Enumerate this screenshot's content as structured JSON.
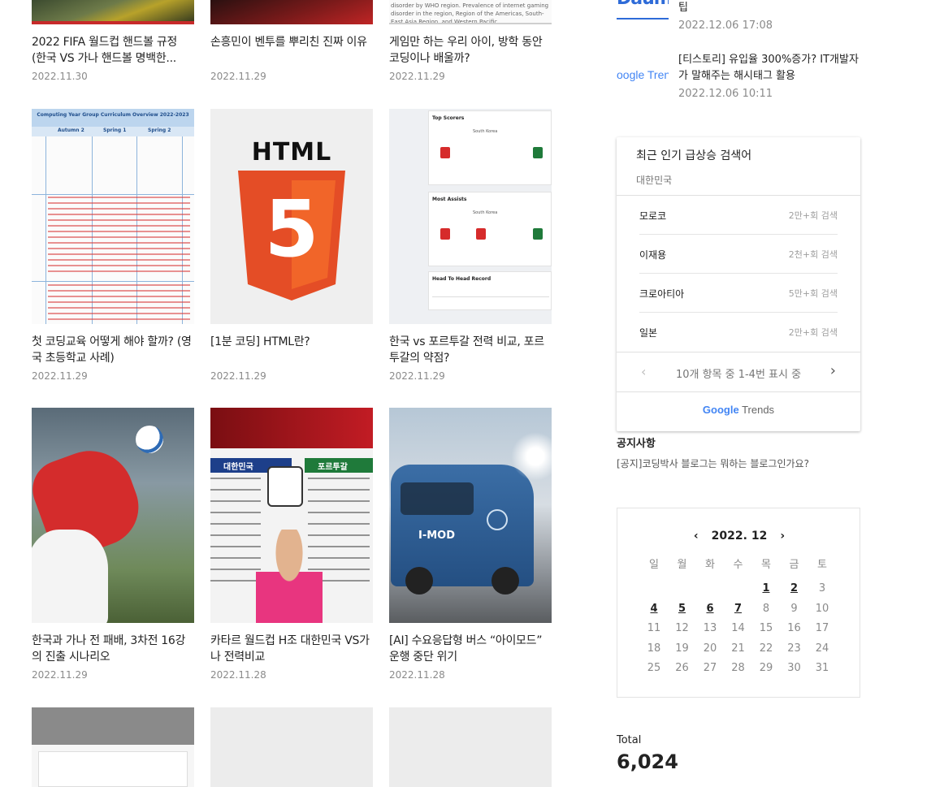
{
  "posts": [
    {
      "title": "2022 FIFA 월드컵 핸드볼 규정 (한국 VS 가나 핸드볼 명백한...",
      "date": "2022.11.30"
    },
    {
      "title": "손흥민이 벤투를 뿌리친 진짜 이유",
      "date": "2022.11.29"
    },
    {
      "title": "게임만 하는 우리 아이, 방학 동안 코딩이나 배울까?",
      "date": "2022.11.29"
    },
    {
      "title": "첫 코딩교육 어떻게 해야 할까? (영국 초등학교 사례)",
      "date": "2022.11.29"
    },
    {
      "title": "[1분 코딩] HTML란?",
      "date": "2022.11.29"
    },
    {
      "title": "한국 vs 포르투갈 전력 비교, 포르투갈의 약점?",
      "date": "2022.11.29"
    },
    {
      "title": "한국과 가나 전 패배, 3차전 16강의 진출 시나리오",
      "date": "2022.11.29"
    },
    {
      "title": "카타르 월드컵 H조 대한민국 VS가나 전력비교",
      "date": "2022.11.28"
    },
    {
      "title": "[AI] 수요응답형 버스 “아이모드” 운행 중단 위기",
      "date": "2022.11.28"
    }
  ],
  "thumb_text": {
    "who_snippet": "disorder by WHO region. Prevalence of internet gaming disorder in the region, Region of the Americas, South-East Asia Region, and Western Pacific",
    "html_logo": "HTML",
    "html_badge": "5",
    "curriculum_title": "Computing Year Group Curriculum Overview 2022-2023",
    "curriculum_cols": [
      "Autumn 2",
      "Spring 1",
      "Spring 2"
    ],
    "stats_top_scorers": "Top Scorers",
    "stats_most_assists": "Most Assists",
    "stats_h2h": "Head To Head Record",
    "stats_team": "South Korea",
    "korea_vs": [
      "대한민국",
      "포르투갈"
    ],
    "bus_label": "I-MOD"
  },
  "sidebar": {
    "recent": [
      {
        "title": "팁",
        "date": "2022.12.06 17:08",
        "logo": "Daum"
      },
      {
        "title": "[티스토리] 유입율 300%증가? IT개발자가 말해주는 해시태그 활용",
        "date": "2022.12.06 10:11",
        "logo": "oogle Tren"
      }
    ],
    "trends": {
      "title": "최근 인기 급상승 검색어",
      "region": "대한민국",
      "items": [
        {
          "term": "모로코",
          "count": "2만+회 검색"
        },
        {
          "term": "이재용",
          "count": "2천+회 검색"
        },
        {
          "term": "크로아티아",
          "count": "5만+회 검색"
        },
        {
          "term": "일본",
          "count": "2만+회 검색"
        }
      ],
      "pager": "10개 항목 중 1-4번 표시 중",
      "brand_google": "Google",
      "brand_trends": " Trends"
    },
    "notice": {
      "heading": "공지사항",
      "item": "[공지]코딩박사 블로그는 뭐하는 블로그인가요?"
    },
    "calendar": {
      "month_label": "2022. 12",
      "prev": "‹",
      "next": "›",
      "weekdays": [
        "일",
        "월",
        "화",
        "수",
        "목",
        "금",
        "토"
      ],
      "weeks": [
        [
          "",
          "",
          "",
          "",
          "1",
          "2",
          "3"
        ],
        [
          "4",
          "5",
          "6",
          "7",
          "8",
          "9",
          "10"
        ],
        [
          "11",
          "12",
          "13",
          "14",
          "15",
          "16",
          "17"
        ],
        [
          "18",
          "19",
          "20",
          "21",
          "22",
          "23",
          "24"
        ],
        [
          "25",
          "26",
          "27",
          "28",
          "29",
          "30",
          "31"
        ]
      ],
      "linked_days": [
        "1",
        "2",
        "4",
        "5",
        "6",
        "7"
      ]
    },
    "total_label": "Total",
    "total_value": "6,024"
  },
  "colors": {
    "google_blue": "#4285F4",
    "google_red": "#EA4335",
    "google_yellow": "#FBBC05",
    "google_green": "#34A853",
    "html5_orange": "#E44D26",
    "korea_red": "#d62b2b"
  }
}
